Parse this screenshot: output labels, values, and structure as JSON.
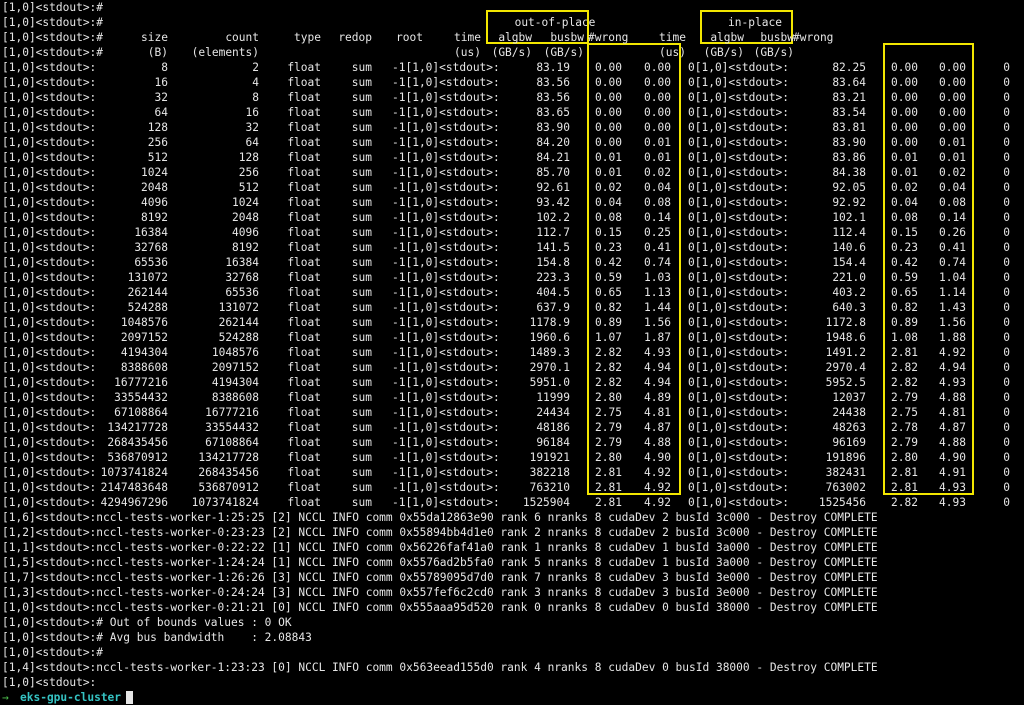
{
  "header": {
    "empty_line": "[1,0]<stdout>:#",
    "prefix": "[1,0]<stdout>:#",
    "out_of_place": "out-of-place",
    "in_place": "in-place",
    "cols1": [
      "size",
      "count",
      "type",
      "redop",
      "root",
      "time",
      "algbw",
      "busbw",
      "#wrong",
      "time",
      "algbw",
      "busbw",
      "#wrong"
    ],
    "cols2": [
      "(B)",
      "(elements)",
      "",
      "",
      "",
      "(us)",
      "(GB/s)",
      "(GB/s)",
      "",
      "(us)",
      "(GB/s)",
      "(GB/s)",
      ""
    ]
  },
  "rows": [
    {
      "p": "[1,0]<stdout>:",
      "size": "8",
      "count": "2",
      "type": "float",
      "redop": "sum",
      "root": "-1[1,0]<stdout>:",
      "t1": "83.19",
      "a1": "0.00",
      "b1": "0.00",
      "w1": "0[1,0]<stdout>:",
      "t2": "82.25",
      "a2": "0.00",
      "b2": "0.00",
      "w2": "0"
    },
    {
      "p": "[1,0]<stdout>:",
      "size": "16",
      "count": "4",
      "type": "float",
      "redop": "sum",
      "root": "-1[1,0]<stdout>:",
      "t1": "83.56",
      "a1": "0.00",
      "b1": "0.00",
      "w1": "0[1,0]<stdout>:",
      "t2": "83.64",
      "a2": "0.00",
      "b2": "0.00",
      "w2": "0"
    },
    {
      "p": "[1,0]<stdout>:",
      "size": "32",
      "count": "8",
      "type": "float",
      "redop": "sum",
      "root": "-1[1,0]<stdout>:",
      "t1": "83.56",
      "a1": "0.00",
      "b1": "0.00",
      "w1": "0[1,0]<stdout>:",
      "t2": "83.21",
      "a2": "0.00",
      "b2": "0.00",
      "w2": "0"
    },
    {
      "p": "[1,0]<stdout>:",
      "size": "64",
      "count": "16",
      "type": "float",
      "redop": "sum",
      "root": "-1[1,0]<stdout>:",
      "t1": "83.65",
      "a1": "0.00",
      "b1": "0.00",
      "w1": "0[1,0]<stdout>:",
      "t2": "83.54",
      "a2": "0.00",
      "b2": "0.00",
      "w2": "0"
    },
    {
      "p": "[1,0]<stdout>:",
      "size": "128",
      "count": "32",
      "type": "float",
      "redop": "sum",
      "root": "-1[1,0]<stdout>:",
      "t1": "83.90",
      "a1": "0.00",
      "b1": "0.00",
      "w1": "0[1,0]<stdout>:",
      "t2": "83.81",
      "a2": "0.00",
      "b2": "0.00",
      "w2": "0"
    },
    {
      "p": "[1,0]<stdout>:",
      "size": "256",
      "count": "64",
      "type": "float",
      "redop": "sum",
      "root": "-1[1,0]<stdout>:",
      "t1": "84.20",
      "a1": "0.00",
      "b1": "0.01",
      "w1": "0[1,0]<stdout>:",
      "t2": "83.90",
      "a2": "0.00",
      "b2": "0.01",
      "w2": "0"
    },
    {
      "p": "[1,0]<stdout>:",
      "size": "512",
      "count": "128",
      "type": "float",
      "redop": "sum",
      "root": "-1[1,0]<stdout>:",
      "t1": "84.21",
      "a1": "0.01",
      "b1": "0.01",
      "w1": "0[1,0]<stdout>:",
      "t2": "83.86",
      "a2": "0.01",
      "b2": "0.01",
      "w2": "0"
    },
    {
      "p": "[1,0]<stdout>:",
      "size": "1024",
      "count": "256",
      "type": "float",
      "redop": "sum",
      "root": "-1[1,0]<stdout>:",
      "t1": "85.70",
      "a1": "0.01",
      "b1": "0.02",
      "w1": "0[1,0]<stdout>:",
      "t2": "84.38",
      "a2": "0.01",
      "b2": "0.02",
      "w2": "0"
    },
    {
      "p": "[1,0]<stdout>:",
      "size": "2048",
      "count": "512",
      "type": "float",
      "redop": "sum",
      "root": "-1[1,0]<stdout>:",
      "t1": "92.61",
      "a1": "0.02",
      "b1": "0.04",
      "w1": "0[1,0]<stdout>:",
      "t2": "92.05",
      "a2": "0.02",
      "b2": "0.04",
      "w2": "0"
    },
    {
      "p": "[1,0]<stdout>:",
      "size": "4096",
      "count": "1024",
      "type": "float",
      "redop": "sum",
      "root": "-1[1,0]<stdout>:",
      "t1": "93.42",
      "a1": "0.04",
      "b1": "0.08",
      "w1": "0[1,0]<stdout>:",
      "t2": "92.92",
      "a2": "0.04",
      "b2": "0.08",
      "w2": "0"
    },
    {
      "p": "[1,0]<stdout>:",
      "size": "8192",
      "count": "2048",
      "type": "float",
      "redop": "sum",
      "root": "-1[1,0]<stdout>:",
      "t1": "102.2",
      "a1": "0.08",
      "b1": "0.14",
      "w1": "0[1,0]<stdout>:",
      "t2": "102.1",
      "a2": "0.08",
      "b2": "0.14",
      "w2": "0"
    },
    {
      "p": "[1,0]<stdout>:",
      "size": "16384",
      "count": "4096",
      "type": "float",
      "redop": "sum",
      "root": "-1[1,0]<stdout>:",
      "t1": "112.7",
      "a1": "0.15",
      "b1": "0.25",
      "w1": "0[1,0]<stdout>:",
      "t2": "112.4",
      "a2": "0.15",
      "b2": "0.26",
      "w2": "0"
    },
    {
      "p": "[1,0]<stdout>:",
      "size": "32768",
      "count": "8192",
      "type": "float",
      "redop": "sum",
      "root": "-1[1,0]<stdout>:",
      "t1": "141.5",
      "a1": "0.23",
      "b1": "0.41",
      "w1": "0[1,0]<stdout>:",
      "t2": "140.6",
      "a2": "0.23",
      "b2": "0.41",
      "w2": "0"
    },
    {
      "p": "[1,0]<stdout>:",
      "size": "65536",
      "count": "16384",
      "type": "float",
      "redop": "sum",
      "root": "-1[1,0]<stdout>:",
      "t1": "154.8",
      "a1": "0.42",
      "b1": "0.74",
      "w1": "0[1,0]<stdout>:",
      "t2": "154.4",
      "a2": "0.42",
      "b2": "0.74",
      "w2": "0"
    },
    {
      "p": "[1,0]<stdout>:",
      "size": "131072",
      "count": "32768",
      "type": "float",
      "redop": "sum",
      "root": "-1[1,0]<stdout>:",
      "t1": "223.3",
      "a1": "0.59",
      "b1": "1.03",
      "w1": "0[1,0]<stdout>:",
      "t2": "221.0",
      "a2": "0.59",
      "b2": "1.04",
      "w2": "0"
    },
    {
      "p": "[1,0]<stdout>:",
      "size": "262144",
      "count": "65536",
      "type": "float",
      "redop": "sum",
      "root": "-1[1,0]<stdout>:",
      "t1": "404.5",
      "a1": "0.65",
      "b1": "1.13",
      "w1": "0[1,0]<stdout>:",
      "t2": "403.2",
      "a2": "0.65",
      "b2": "1.14",
      "w2": "0"
    },
    {
      "p": "[1,0]<stdout>:",
      "size": "524288",
      "count": "131072",
      "type": "float",
      "redop": "sum",
      "root": "-1[1,0]<stdout>:",
      "t1": "637.9",
      "a1": "0.82",
      "b1": "1.44",
      "w1": "0[1,0]<stdout>:",
      "t2": "640.3",
      "a2": "0.82",
      "b2": "1.43",
      "w2": "0"
    },
    {
      "p": "[1,0]<stdout>:",
      "size": "1048576",
      "count": "262144",
      "type": "float",
      "redop": "sum",
      "root": "-1[1,0]<stdout>:",
      "t1": "1178.9",
      "a1": "0.89",
      "b1": "1.56",
      "w1": "0[1,0]<stdout>:",
      "t2": "1172.8",
      "a2": "0.89",
      "b2": "1.56",
      "w2": "0"
    },
    {
      "p": "[1,0]<stdout>:",
      "size": "2097152",
      "count": "524288",
      "type": "float",
      "redop": "sum",
      "root": "-1[1,0]<stdout>:",
      "t1": "1960.6",
      "a1": "1.07",
      "b1": "1.87",
      "w1": "0[1,0]<stdout>:",
      "t2": "1948.6",
      "a2": "1.08",
      "b2": "1.88",
      "w2": "0"
    },
    {
      "p": "[1,0]<stdout>:",
      "size": "4194304",
      "count": "1048576",
      "type": "float",
      "redop": "sum",
      "root": "-1[1,0]<stdout>:",
      "t1": "1489.3",
      "a1": "2.82",
      "b1": "4.93",
      "w1": "0[1,0]<stdout>:",
      "t2": "1491.2",
      "a2": "2.81",
      "b2": "4.92",
      "w2": "0"
    },
    {
      "p": "[1,0]<stdout>:",
      "size": "8388608",
      "count": "2097152",
      "type": "float",
      "redop": "sum",
      "root": "-1[1,0]<stdout>:",
      "t1": "2970.1",
      "a1": "2.82",
      "b1": "4.94",
      "w1": "0[1,0]<stdout>:",
      "t2": "2970.4",
      "a2": "2.82",
      "b2": "4.94",
      "w2": "0"
    },
    {
      "p": "[1,0]<stdout>:",
      "size": "16777216",
      "count": "4194304",
      "type": "float",
      "redop": "sum",
      "root": "-1[1,0]<stdout>:",
      "t1": "5951.0",
      "a1": "2.82",
      "b1": "4.94",
      "w1": "0[1,0]<stdout>:",
      "t2": "5952.5",
      "a2": "2.82",
      "b2": "4.93",
      "w2": "0"
    },
    {
      "p": "[1,0]<stdout>:",
      "size": "33554432",
      "count": "8388608",
      "type": "float",
      "redop": "sum",
      "root": "-1[1,0]<stdout>:",
      "t1": "11999",
      "a1": "2.80",
      "b1": "4.89",
      "w1": "0[1,0]<stdout>:",
      "t2": "12037",
      "a2": "2.79",
      "b2": "4.88",
      "w2": "0"
    },
    {
      "p": "[1,0]<stdout>:",
      "size": "67108864",
      "count": "16777216",
      "type": "float",
      "redop": "sum",
      "root": "-1[1,0]<stdout>:",
      "t1": "24434",
      "a1": "2.75",
      "b1": "4.81",
      "w1": "0[1,0]<stdout>:",
      "t2": "24438",
      "a2": "2.75",
      "b2": "4.81",
      "w2": "0"
    },
    {
      "p": "[1,0]<stdout>:",
      "size": "134217728",
      "count": "33554432",
      "type": "float",
      "redop": "sum",
      "root": "-1[1,0]<stdout>:",
      "t1": "48186",
      "a1": "2.79",
      "b1": "4.87",
      "w1": "0[1,0]<stdout>:",
      "t2": "48263",
      "a2": "2.78",
      "b2": "4.87",
      "w2": "0"
    },
    {
      "p": "[1,0]<stdout>:",
      "size": "268435456",
      "count": "67108864",
      "type": "float",
      "redop": "sum",
      "root": "-1[1,0]<stdout>:",
      "t1": "96184",
      "a1": "2.79",
      "b1": "4.88",
      "w1": "0[1,0]<stdout>:",
      "t2": "96169",
      "a2": "2.79",
      "b2": "4.88",
      "w2": "0"
    },
    {
      "p": "[1,0]<stdout>:",
      "size": "536870912",
      "count": "134217728",
      "type": "float",
      "redop": "sum",
      "root": "-1[1,0]<stdout>:",
      "t1": "191921",
      "a1": "2.80",
      "b1": "4.90",
      "w1": "0[1,0]<stdout>:",
      "t2": "191896",
      "a2": "2.80",
      "b2": "4.90",
      "w2": "0"
    },
    {
      "p": "[1,0]<stdout>:",
      "size": "1073741824",
      "count": "268435456",
      "type": "float",
      "redop": "sum",
      "root": "-1[1,0]<stdout>:",
      "t1": "382218",
      "a1": "2.81",
      "b1": "4.92",
      "w1": "0[1,0]<stdout>:",
      "t2": "382431",
      "a2": "2.81",
      "b2": "4.91",
      "w2": "0"
    },
    {
      "p": "[1,0]<stdout>:",
      "size": "2147483648",
      "count": "536870912",
      "type": "float",
      "redop": "sum",
      "root": "-1[1,0]<stdout>:",
      "t1": "763210",
      "a1": "2.81",
      "b1": "4.92",
      "w1": "0[1,0]<stdout>:",
      "t2": "763002",
      "a2": "2.81",
      "b2": "4.93",
      "w2": "0"
    },
    {
      "p": "[1,0]<stdout>:",
      "size": "4294967296",
      "count": "1073741824",
      "type": "float",
      "redop": "sum",
      "root": "-1[1,0]<stdout>:",
      "t1": "1525904",
      "a1": "2.81",
      "b1": "4.92",
      "w1": "0[1,0]<stdout>:",
      "t2": "1525456",
      "a2": "2.82",
      "b2": "4.93",
      "w2": "0"
    }
  ],
  "footer_lines": [
    "[1,6]<stdout>:nccl-tests-worker-1:25:25 [2] NCCL INFO comm 0x55da12863e90 rank 6 nranks 8 cudaDev 2 busId 3c000 - Destroy COMPLETE",
    "[1,2]<stdout>:nccl-tests-worker-0:23:23 [2] NCCL INFO comm 0x55894bb4d1e0 rank 2 nranks 8 cudaDev 2 busId 3c000 - Destroy COMPLETE",
    "[1,1]<stdout>:nccl-tests-worker-0:22:22 [1] NCCL INFO comm 0x56226faf41a0 rank 1 nranks 8 cudaDev 1 busId 3a000 - Destroy COMPLETE",
    "[1,5]<stdout>:nccl-tests-worker-1:24:24 [1] NCCL INFO comm 0x5576ad2b5fa0 rank 5 nranks 8 cudaDev 1 busId 3a000 - Destroy COMPLETE",
    "[1,7]<stdout>:nccl-tests-worker-1:26:26 [3] NCCL INFO comm 0x55789095d7d0 rank 7 nranks 8 cudaDev 3 busId 3e000 - Destroy COMPLETE",
    "[1,3]<stdout>:nccl-tests-worker-0:24:24 [3] NCCL INFO comm 0x557fef6c2cd0 rank 3 nranks 8 cudaDev 3 busId 3e000 - Destroy COMPLETE",
    "[1,0]<stdout>:nccl-tests-worker-0:21:21 [0] NCCL INFO comm 0x555aaa95d520 rank 0 nranks 8 cudaDev 0 busId 38000 - Destroy COMPLETE",
    "[1,0]<stdout>:# Out of bounds values : 0 OK",
    "[1,0]<stdout>:# Avg bus bandwidth    : 2.08843",
    "[1,0]<stdout>:#",
    "[1,4]<stdout>:nccl-tests-worker-1:23:23 [0] NCCL INFO comm 0x563eead155d0 rank 4 nranks 8 cudaDev 0 busId 38000 - Destroy COMPLETE",
    "[1,0]<stdout>:"
  ],
  "prompt": {
    "arrow": "→",
    "dir": "eks-gpu-cluster"
  },
  "colors": {
    "background": "#000000",
    "text": "#e6e6e6",
    "highlight_box": "#f2e600",
    "prompt_arrow": "#4fc34f",
    "prompt_dir": "#35c2c2"
  }
}
